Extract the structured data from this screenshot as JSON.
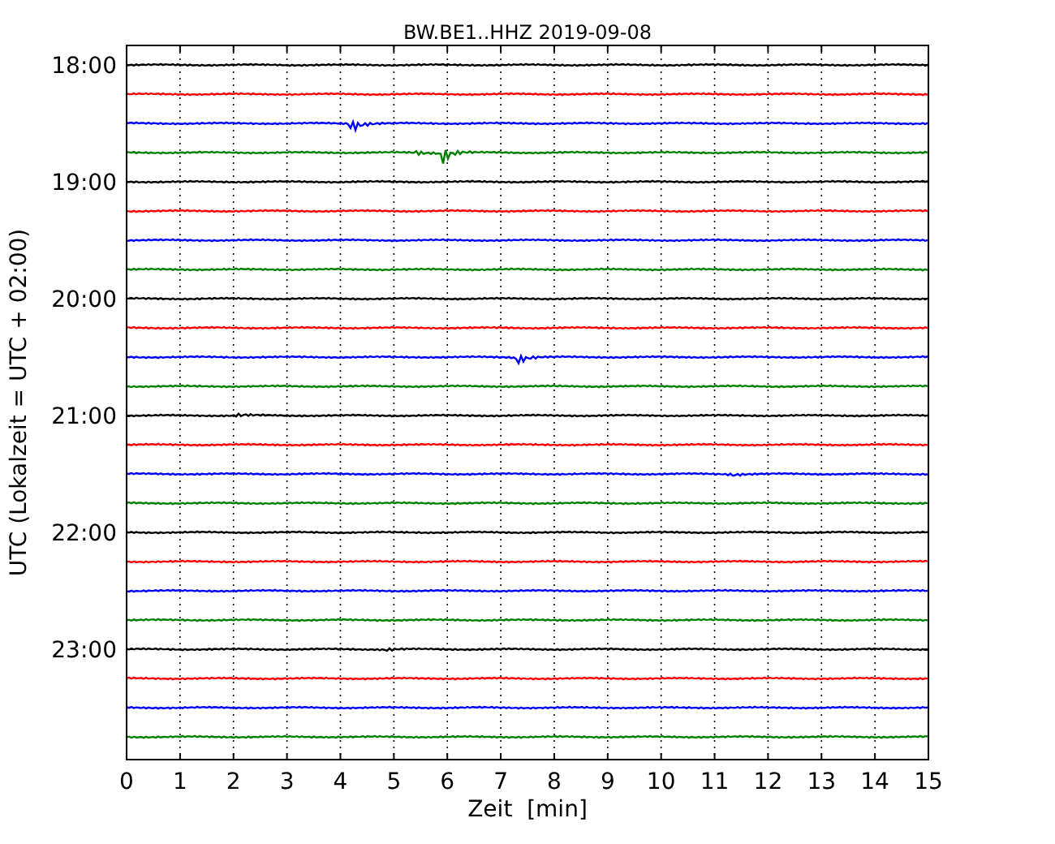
{
  "title": "BW.BE1..HHZ 2019-09-08",
  "xlabel": "Zeit  [min]",
  "ylabel": "UTC (Lokalzeit = UTC + 02:00)",
  "xticks": [
    "0",
    "1",
    "2",
    "3",
    "4",
    "5",
    "6",
    "7",
    "8",
    "9",
    "10",
    "11",
    "12",
    "13",
    "14",
    "15"
  ],
  "traces": [
    {
      "color": "#000000",
      "label": "18:00"
    },
    {
      "color": "#ff0000"
    },
    {
      "color": "#0000ff"
    },
    {
      "color": "#008000"
    },
    {
      "color": "#000000",
      "label": "19:00"
    },
    {
      "color": "#ff0000"
    },
    {
      "color": "#0000ff"
    },
    {
      "color": "#008000"
    },
    {
      "color": "#000000",
      "label": "20:00"
    },
    {
      "color": "#ff0000"
    },
    {
      "color": "#0000ff"
    },
    {
      "color": "#008000"
    },
    {
      "color": "#000000",
      "label": "21:00"
    },
    {
      "color": "#ff0000"
    },
    {
      "color": "#0000ff"
    },
    {
      "color": "#008000"
    },
    {
      "color": "#000000",
      "label": "22:00"
    },
    {
      "color": "#ff0000"
    },
    {
      "color": "#0000ff"
    },
    {
      "color": "#008000"
    },
    {
      "color": "#000000",
      "label": "23:00"
    },
    {
      "color": "#ff0000"
    },
    {
      "color": "#0000ff"
    },
    {
      "color": "#008000"
    }
  ]
}
